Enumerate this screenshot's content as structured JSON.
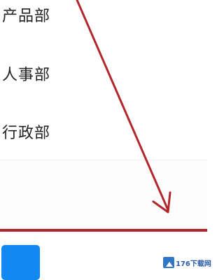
{
  "department_list": {
    "items": [
      {
        "label": "产品部"
      },
      {
        "label": "人事部"
      },
      {
        "label": "行政部"
      }
    ]
  },
  "bottom_bar": {
    "app_tile_color": "#1288f3"
  },
  "watermark": {
    "text": "176下载网"
  },
  "annotation": {
    "arrow_color": "#b3262b",
    "divider_color": "#b3262b"
  }
}
